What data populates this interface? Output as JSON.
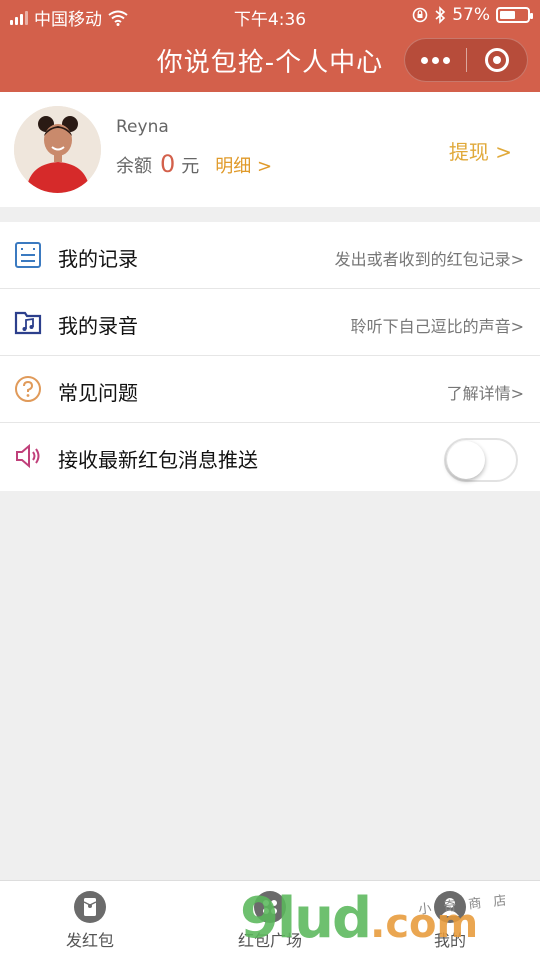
{
  "status_bar": {
    "carrier": "中国移动",
    "time": "下午4:36",
    "battery_pct": "57%",
    "battery_level": 0.57
  },
  "navbar": {
    "title": "你说包抢-个人中心"
  },
  "profile": {
    "username": "Reyna",
    "balance_label": "余额",
    "balance_amount": "0",
    "balance_unit": "元",
    "detail_link": "明细 >",
    "withdraw_label": "提现 >"
  },
  "menu": {
    "items": [
      {
        "icon": "record-list-icon",
        "label": "我的记录",
        "hint": "发出或者收到的红包记录>"
      },
      {
        "icon": "music-folder-icon",
        "label": "我的录音",
        "hint": "聆听下自己逗比的声音>"
      },
      {
        "icon": "question-circle-icon",
        "label": "常见问题",
        "hint": "了解详情>"
      },
      {
        "icon": "speaker-icon",
        "label": "接收最新红包消息推送",
        "toggle_on": false
      }
    ]
  },
  "tabbar": {
    "tabs": [
      {
        "label": "发红包",
        "icon": "red-envelope-icon"
      },
      {
        "label": "红包广场",
        "icon": "square-icon"
      },
      {
        "label": "我的",
        "icon": "user-icon"
      }
    ]
  },
  "watermark": {
    "text": "9lud",
    "suffix": ".com",
    "small_text": "小 奇 商 店"
  },
  "colors": {
    "brand": "#d3604b",
    "accent": "#e0a93a",
    "icon_blue": "#2c4a8c",
    "icon_orange": "#e09a5a",
    "icon_pink": "#c0407a"
  }
}
